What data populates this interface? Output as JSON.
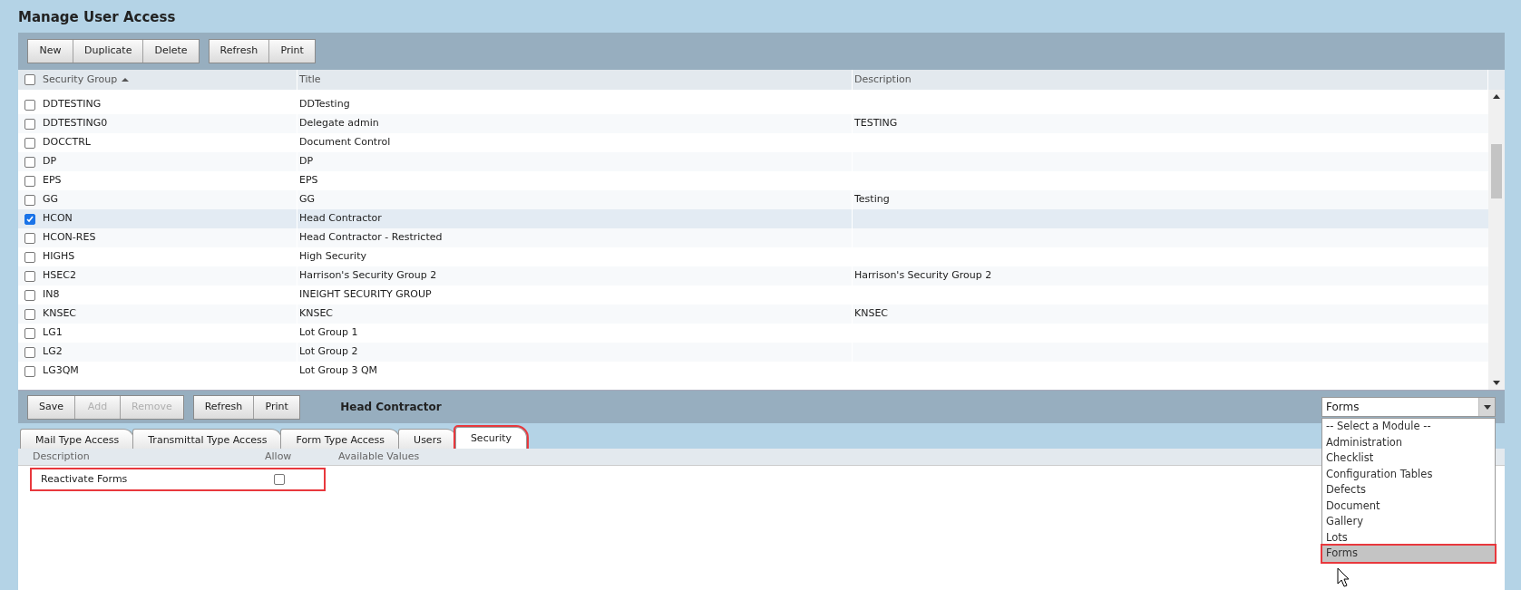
{
  "page_title": "Manage User Access",
  "toolbar": {
    "groups": [
      [
        "New",
        "Duplicate",
        "Delete"
      ],
      [
        "Refresh",
        "Print"
      ]
    ]
  },
  "table": {
    "columns": [
      {
        "label": "Security Group",
        "sorted": true
      },
      {
        "label": "Title",
        "sorted": false
      },
      {
        "label": "Description",
        "sorted": false
      }
    ],
    "all_checked": false,
    "rows": [
      {
        "cells": [
          "DDTESTING",
          "DDTesting",
          ""
        ],
        "checked": false
      },
      {
        "cells": [
          "DDTESTING0",
          "Delegate admin",
          "TESTING"
        ],
        "checked": false
      },
      {
        "cells": [
          "DOCCTRL",
          "Document Control",
          ""
        ],
        "checked": false
      },
      {
        "cells": [
          "DP",
          "DP",
          ""
        ],
        "checked": false
      },
      {
        "cells": [
          "EPS",
          "EPS",
          ""
        ],
        "checked": false
      },
      {
        "cells": [
          "GG",
          "GG",
          "Testing"
        ],
        "checked": false
      },
      {
        "cells": [
          "HCON",
          "Head Contractor",
          ""
        ],
        "checked": true
      },
      {
        "cells": [
          "HCON-RES",
          "Head Contractor - Restricted",
          ""
        ],
        "checked": false
      },
      {
        "cells": [
          "HIGHS",
          "High Security",
          ""
        ],
        "checked": false
      },
      {
        "cells": [
          "HSEC2",
          "Harrison's Security Group 2",
          "Harrison's Security Group 2"
        ],
        "checked": false
      },
      {
        "cells": [
          "IN8",
          "INEIGHT SECURITY GROUP",
          ""
        ],
        "checked": false
      },
      {
        "cells": [
          "KNSEC",
          "KNSEC",
          "KNSEC"
        ],
        "checked": false
      },
      {
        "cells": [
          "LG1",
          "Lot Group 1",
          ""
        ],
        "checked": false
      },
      {
        "cells": [
          "LG2",
          "Lot Group 2",
          ""
        ],
        "checked": false
      },
      {
        "cells": [
          "LG3QM",
          "Lot Group 3 QM",
          ""
        ],
        "checked": false
      }
    ]
  },
  "detail_toolbar": {
    "groups": [
      [
        {
          "label": "Save",
          "disabled": false
        },
        {
          "label": "Add",
          "disabled": true
        },
        {
          "label": "Remove",
          "disabled": true
        }
      ],
      [
        {
          "label": "Refresh",
          "disabled": false
        },
        {
          "label": "Print",
          "disabled": false
        }
      ]
    ],
    "heading": "Head Contractor"
  },
  "module_select": {
    "value": "Forms",
    "expanded": true,
    "options": [
      {
        "label": "-- Select a Module --",
        "selected": false,
        "highlighted": false
      },
      {
        "label": "Administration",
        "selected": false,
        "highlighted": false
      },
      {
        "label": "Checklist",
        "selected": false,
        "highlighted": false
      },
      {
        "label": "Configuration Tables",
        "selected": false,
        "highlighted": false
      },
      {
        "label": "Defects",
        "selected": false,
        "highlighted": false
      },
      {
        "label": "Document",
        "selected": false,
        "highlighted": false
      },
      {
        "label": "Gallery",
        "selected": false,
        "highlighted": false
      },
      {
        "label": "Lots",
        "selected": false,
        "highlighted": false
      },
      {
        "label": "Forms",
        "selected": true,
        "highlighted": true
      }
    ]
  },
  "tabs": [
    {
      "label": "Mail Type Access",
      "selected": false,
      "highlighted": false
    },
    {
      "label": "Transmittal Type Access",
      "selected": false,
      "highlighted": false
    },
    {
      "label": "Form Type Access",
      "selected": false,
      "highlighted": false
    },
    {
      "label": "Users",
      "selected": false,
      "highlighted": false
    },
    {
      "label": "Security",
      "selected": true,
      "highlighted": true
    }
  ],
  "security": {
    "columns": [
      "Description",
      "Allow",
      "Available Values"
    ],
    "rows": [
      {
        "description": "Reactivate Forms",
        "allow": false,
        "highlighted": true
      }
    ]
  }
}
